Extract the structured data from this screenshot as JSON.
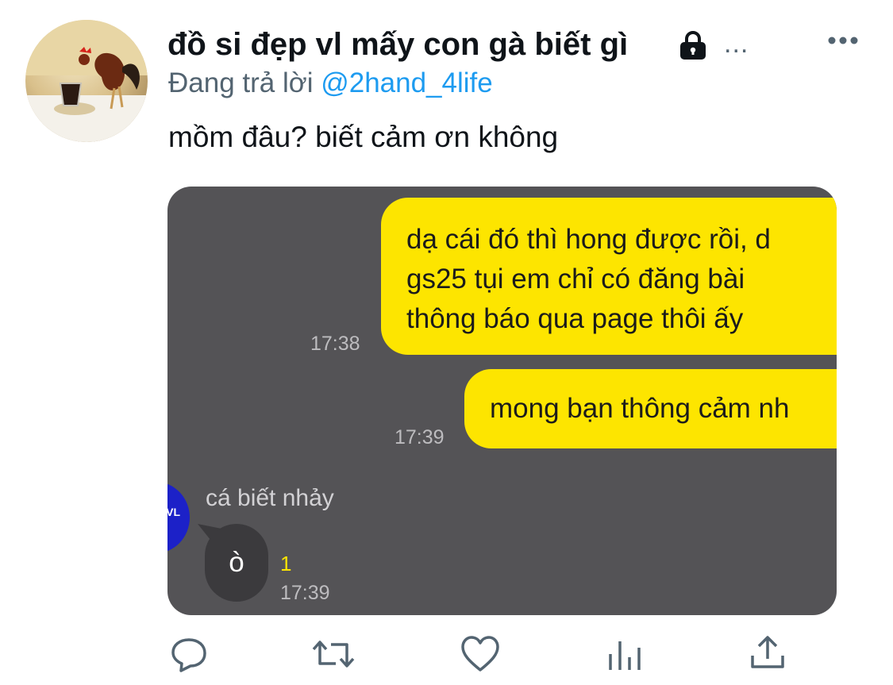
{
  "tweet": {
    "display_name": "đồ si đẹp vl mấy con gà biết gì",
    "ellipsis": "...",
    "reply_prefix": "Đang trả lời",
    "reply_handle": "@2hand_4life",
    "text": "mồm đâu? biết cảm ơn không"
  },
  "chat": {
    "messages_sent": [
      {
        "lines": [
          "dạ cái đó thì hong được rồi, d",
          "gs25 tụi em chỉ có đăng bài",
          "thông báo qua page thôi ấy"
        ],
        "time": "17:38"
      },
      {
        "lines": [
          "mong bạn thông cảm nh"
        ],
        "time": "17:39"
      }
    ],
    "received": {
      "sender_avatar_text": "VL",
      "sender_name": "cá biết nhảy",
      "text": "ò",
      "unread_count": "1",
      "time": "17:39"
    }
  },
  "actions": [
    "reply-icon",
    "retweet-icon",
    "like-icon",
    "analytics-icon",
    "share-icon"
  ],
  "colors": {
    "accent": "#1d9bf0",
    "chat_bg": "#545356",
    "bubble_yellow": "#fde500",
    "secondary_text": "#536471"
  }
}
